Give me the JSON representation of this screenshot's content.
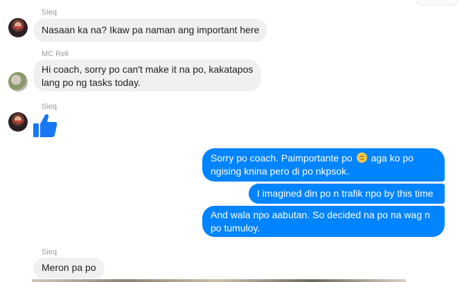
{
  "messages": [
    {
      "sender": "Sieq",
      "text": "Nasaan ka na? Ikaw pa naman ang important here"
    },
    {
      "sender": "MC Reli",
      "line1": "Hi coach, sorry po can't make it na po, kakatapos",
      "line2": "lang po ng tasks today."
    },
    {
      "sender": "Sieq",
      "reaction": "thumbs-up-icon"
    },
    {
      "sender": "Sieq",
      "text": "Meron pa po"
    }
  ],
  "outgoing": [
    {
      "line1_a": "Sorry po coach. Paimportante po",
      "line1_b": "aga ko po",
      "line2": "ngising knina pero di po nkpsok."
    },
    {
      "text": "I imagined din po n trafik npo by this time"
    },
    {
      "line1": "And wala npo aabutan. So decided na po na wag n",
      "line2": "po tumuloy."
    }
  ],
  "colors": {
    "outgoing_bubble": "#0084ff",
    "incoming_bubble": "#f1f0f0",
    "like_icon": "#1877f2"
  }
}
